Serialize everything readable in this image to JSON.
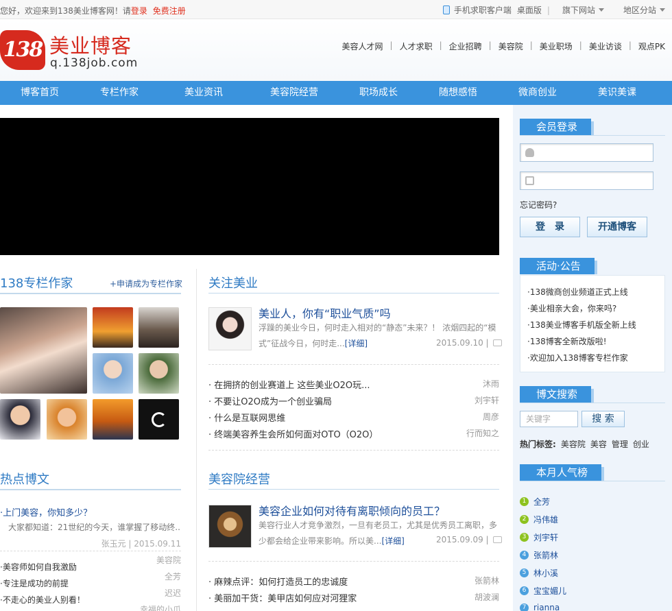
{
  "topbar": {
    "welcome_prefix": "您好，欢迎来到138美业博客网！请",
    "login": "登录",
    "register": "免费注册",
    "mobile_client": "手机求职客户端",
    "desktop": "桌面版",
    "sites": "旗下网站",
    "region": "地区分站"
  },
  "logo": {
    "number": "138",
    "name": "美业博客",
    "domain": "q.138job.com",
    "brand_color": "#d62a1e"
  },
  "top_links": [
    "美容人才网",
    "人才求职",
    "企业招聘",
    "美容院",
    "美业职场",
    "美业访谈",
    "观点PK"
  ],
  "main_nav": [
    "博客首页",
    "专栏作家",
    "美业资讯",
    "美容院经营",
    "职场成长",
    "随想感悟",
    "微商创业",
    "美识美课"
  ],
  "sidebar": {
    "login": {
      "title": "会员登录",
      "forgot": "忘记密码?",
      "login_btn": "登　录",
      "open_btn": "开通博客"
    },
    "notice": {
      "title": "活动·公告",
      "items": [
        "·138微商创业频道正式上线",
        "·美业相亲大会，你来吗?",
        "·138美业博客手机版全新上线",
        "·138博客全新改版啦!",
        "·欢迎加入138博客专栏作家"
      ]
    },
    "search": {
      "title": "博文搜索",
      "placeholder": "关键字",
      "btn": "搜 索",
      "hot_label": "热门标签:",
      "tags": [
        "美容院",
        "美容",
        "管理",
        "创业"
      ]
    },
    "ranking": {
      "title": "本月人气榜",
      "items": [
        {
          "n": "1",
          "name": "全芳"
        },
        {
          "n": "2",
          "name": "冯伟雄"
        },
        {
          "n": "3",
          "name": "刘宇轩"
        },
        {
          "n": "4",
          "name": "张箭林"
        },
        {
          "n": "5",
          "name": "林小溪"
        },
        {
          "n": "6",
          "name": "宝宝媚儿"
        },
        {
          "n": "7",
          "name": "rianna"
        }
      ]
    }
  },
  "columnists": {
    "title": "138专栏作家",
    "apply": "+申请成为专栏作家"
  },
  "hot_posts": {
    "title": "热点博文",
    "first_title": "·上门美容，你知多少？",
    "first_summary": "大家都知道：21世纪的今天，谁掌握了移动终...",
    "first_meta": "张玉元 | 2015.09.11",
    "items": [
      {
        "title": "·美容师如何自我激励",
        "author": "美容院"
      },
      {
        "title": "·专注是成功的前提",
        "author": "全芳"
      },
      {
        "title": "·不走心的美业人别看！",
        "author": "迟迟"
      },
      {
        "title": "",
        "author": "幸福的小爪"
      }
    ]
  },
  "focus": {
    "title": "关注美业",
    "featured": {
      "title": "美业人，你有“职业气质”吗",
      "summary": "浮躁的美业今日，何时走入相对的“静态”未来？！ 浓烟四起的“模式”征战今日，何时走...",
      "more": "[详细]",
      "date": "2015.09.10 |"
    },
    "items": [
      {
        "title": "· 在拥挤的创业赛道上 这些美业O2O玩...",
        "author": "沐雨"
      },
      {
        "title": "· 不要让O2O成为一个创业骗局",
        "author": "刘宇轩"
      },
      {
        "title": "· 什么是互联网思维",
        "author": "周彦"
      },
      {
        "title": "· 终端美容养生会所如何面对OTO（O2O）",
        "author": "行而知之"
      }
    ]
  },
  "salon": {
    "title": "美容院经营",
    "featured": {
      "title": "美容企业如何对待有离职倾向的员工？",
      "summary": "美容行业人才竞争激烈，一旦有老员工，尤其是优秀员工离职，多少都会给企业带来影响。所以美...",
      "more": "[详细]",
      "date": "2015.09.09 |"
    },
    "items": [
      {
        "title": "· 麻辣点评：如何打造员工的忠诚度",
        "author": "张箭林"
      },
      {
        "title": "· 美丽加干货：美甲店如何应对河狸家",
        "author": "胡波澜"
      }
    ]
  },
  "colors": {
    "nav": "#3a93dd",
    "link": "#1d4f9a",
    "sidebar_bg": "#eef4fb"
  }
}
